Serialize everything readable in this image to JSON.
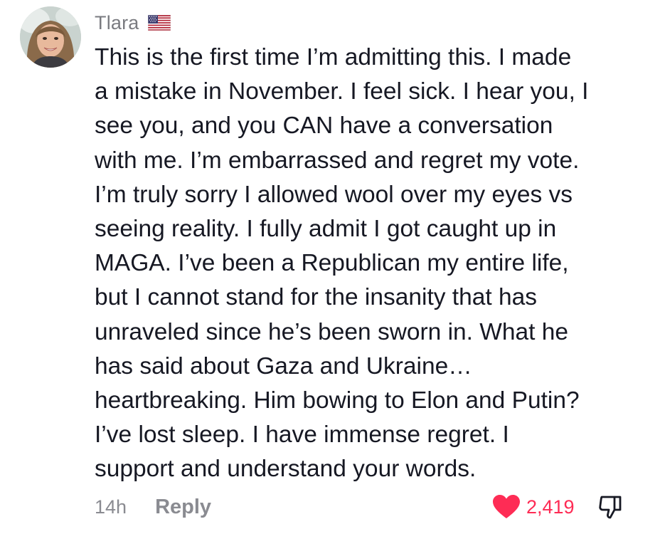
{
  "comment": {
    "username": "Tlara",
    "flag_icon": "us-flag-icon",
    "text": "This is the first time I’m admitting this. I made\na mistake in November. I feel sick. I hear you, I\nsee you, and you CAN have a conversation\nwith me. I’m embarrassed and regret my vote.\nI’m truly sorry I allowed wool over my eyes vs\nseeing reality. I fully admit I got caught up in\nMAGA. I’ve been a Republican my entire life,\nbut I cannot stand for the insanity that has\nunraveled since he’s been sworn in. What he\nhas said about Gaza and Ukraine…\nheartbreaking. Him bowing to Elon and Putin?\nI’ve lost sleep. I have immense regret. I\nsupport and understand your words.",
    "timestamp": "14h",
    "reply_label": "Reply",
    "like_count": "2,419",
    "like_icon": "heart-icon",
    "dislike_icon": "thumbs-down-icon",
    "colors": {
      "like": "#fe2c55",
      "meta_text": "#8a8b91",
      "body_text": "#161823"
    }
  }
}
